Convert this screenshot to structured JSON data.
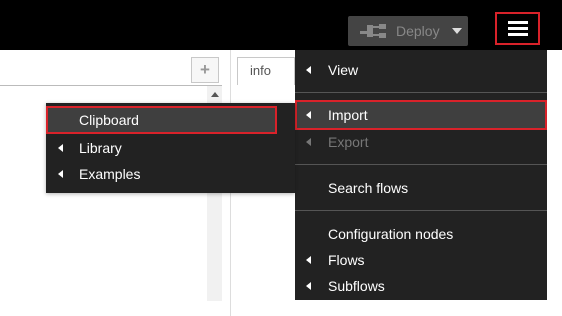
{
  "header": {
    "deploy_label": "Deploy",
    "deploy_icon": "deploy-icon",
    "menu_icon": "hamburger-menu-icon",
    "highlight_color": "#d9222a"
  },
  "workspace": {
    "add_tab_label": "+",
    "sidebar_tab_label": "info"
  },
  "main_menu": {
    "items": [
      {
        "label": "View",
        "submenu": true,
        "enabled": true
      },
      {
        "label": "Import",
        "submenu": true,
        "enabled": true,
        "highlighted": true
      },
      {
        "label": "Export",
        "submenu": true,
        "enabled": false
      },
      {
        "label": "Search flows",
        "submenu": false,
        "enabled": true
      },
      {
        "label": "Configuration nodes",
        "submenu": false,
        "enabled": true
      },
      {
        "label": "Flows",
        "submenu": true,
        "enabled": true
      },
      {
        "label": "Subflows",
        "submenu": true,
        "enabled": true
      }
    ]
  },
  "import_submenu": {
    "items": [
      {
        "label": "Clipboard",
        "submenu": false,
        "highlighted": true
      },
      {
        "label": "Library",
        "submenu": true
      },
      {
        "label": "Examples",
        "submenu": true
      }
    ]
  }
}
